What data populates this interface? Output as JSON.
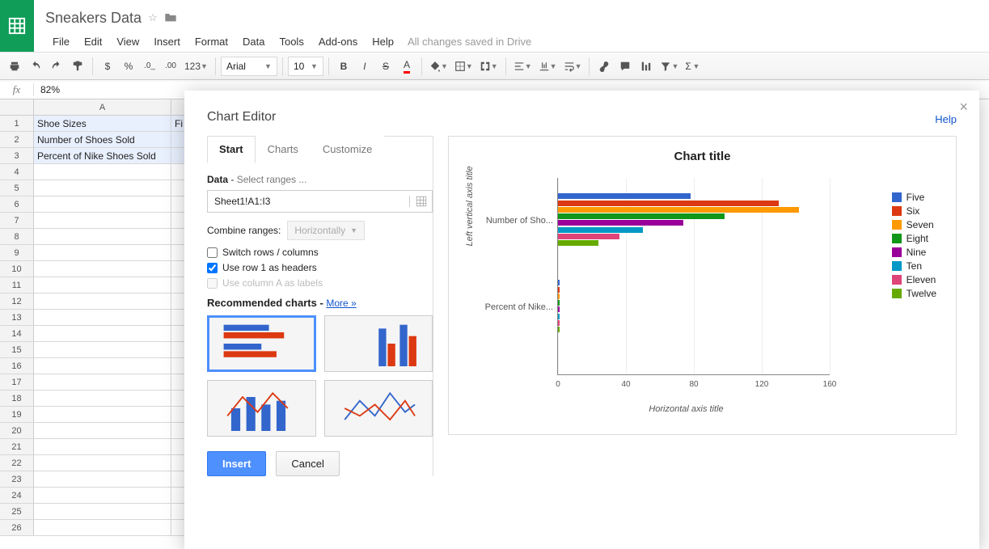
{
  "doc_title": "Sneakers Data",
  "menus": [
    "File",
    "Edit",
    "View",
    "Insert",
    "Format",
    "Data",
    "Tools",
    "Add-ons",
    "Help"
  ],
  "save_status": "All changes saved in Drive",
  "font_name": "Arial",
  "font_size": "10",
  "formula_value": "82%",
  "col_header": "A",
  "rows_data": {
    "1": "Shoe Sizes",
    "2": "Number of Shoes Sold",
    "3": "Percent of Nike Shoes Sold"
  },
  "partial_col_b": "Fi",
  "dialog": {
    "title": "Chart Editor",
    "help": "Help",
    "tabs": [
      "Start",
      "Charts",
      "Customize"
    ],
    "data_label": "Data",
    "select_ranges_hint": "Select ranges ...",
    "range": "Sheet1!A1:I3",
    "combine_label": "Combine ranges:",
    "combine_value": "Horizontally",
    "switch_label": "Switch rows / columns",
    "use_row1_label": "Use row 1 as headers",
    "use_colA_label": "Use column A as labels",
    "rec_label": "Recommended charts",
    "more": "More »",
    "insert": "Insert",
    "cancel": "Cancel"
  },
  "legend": [
    "Five",
    "Six",
    "Seven",
    "Eight",
    "Nine",
    "Ten",
    "Eleven",
    "Twelve"
  ],
  "colors": [
    "#3366cc",
    "#dc3912",
    "#ff9900",
    "#109618",
    "#990099",
    "#0099c6",
    "#dd4477",
    "#66aa00"
  ],
  "preview": {
    "title": "Chart title",
    "y_title": "Left vertical axis title",
    "x_title": "Horizontal axis title",
    "cat1": "Number of Sho...",
    "cat2": "Percent of Nike...",
    "ticks": [
      "0",
      "40",
      "80",
      "120",
      "160"
    ]
  },
  "chart_data": {
    "type": "bar",
    "orientation": "horizontal",
    "title": "Chart title",
    "xlabel": "Horizontal axis title",
    "ylabel": "Left vertical axis title",
    "xlim": [
      0,
      160
    ],
    "categories": [
      "Number of Shoes Sold",
      "Percent of Nike Shoes Sold"
    ],
    "series": [
      {
        "name": "Five",
        "values": [
          78,
          0.8
        ]
      },
      {
        "name": "Six",
        "values": [
          130,
          0.8
        ]
      },
      {
        "name": "Seven",
        "values": [
          142,
          0.8
        ]
      },
      {
        "name": "Eight",
        "values": [
          98,
          0.8
        ]
      },
      {
        "name": "Nine",
        "values": [
          74,
          0.8
        ]
      },
      {
        "name": "Ten",
        "values": [
          50,
          0.8
        ]
      },
      {
        "name": "Eleven",
        "values": [
          36,
          0.8
        ]
      },
      {
        "name": "Twelve",
        "values": [
          24,
          0.8
        ]
      }
    ]
  }
}
